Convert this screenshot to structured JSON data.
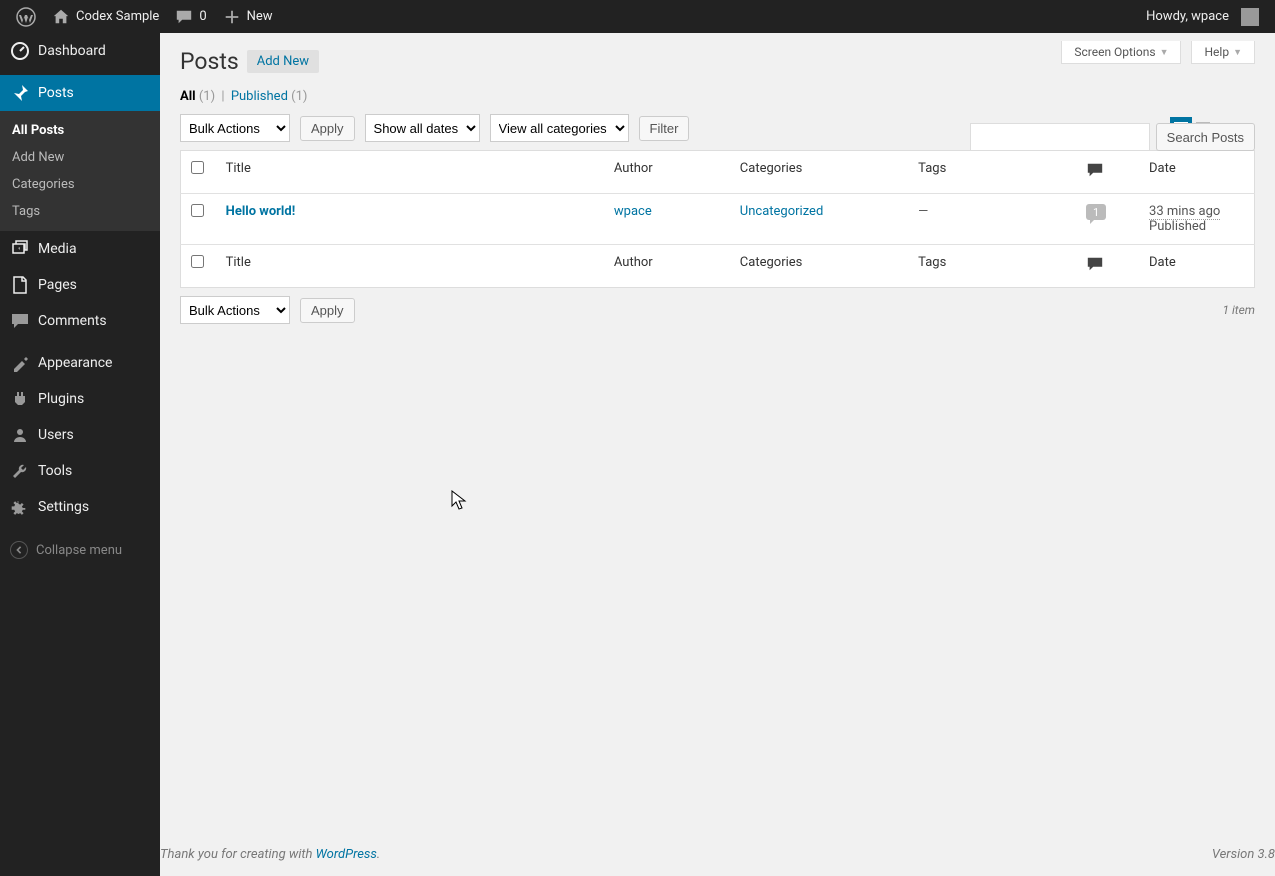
{
  "topbar": {
    "site_name": "Codex Sample",
    "comments_count": "0",
    "new_label": "New",
    "howdy": "Howdy, wpace"
  },
  "sidebar": {
    "items": [
      {
        "id": "dashboard",
        "label": "Dashboard"
      },
      {
        "id": "posts",
        "label": "Posts"
      },
      {
        "id": "media",
        "label": "Media"
      },
      {
        "id": "pages",
        "label": "Pages"
      },
      {
        "id": "comments",
        "label": "Comments"
      },
      {
        "id": "appearance",
        "label": "Appearance"
      },
      {
        "id": "plugins",
        "label": "Plugins"
      },
      {
        "id": "users",
        "label": "Users"
      },
      {
        "id": "tools",
        "label": "Tools"
      },
      {
        "id": "settings",
        "label": "Settings"
      }
    ],
    "submenu_posts": [
      {
        "label": "All Posts",
        "current": true
      },
      {
        "label": "Add New"
      },
      {
        "label": "Categories"
      },
      {
        "label": "Tags"
      }
    ],
    "collapse_label": "Collapse menu"
  },
  "screen": {
    "screen_options": "Screen Options",
    "help": "Help"
  },
  "page": {
    "title": "Posts",
    "add_new": "Add New"
  },
  "filters": {
    "all_label": "All",
    "all_count": "(1)",
    "published_label": "Published",
    "published_count": "(1)"
  },
  "search": {
    "button": "Search Posts"
  },
  "bulk_actions": {
    "label": "Bulk Actions",
    "apply": "Apply"
  },
  "date_filter": "Show all dates",
  "cat_filter": "View all categories",
  "filter_btn": "Filter",
  "item_count": "1 item",
  "columns": {
    "title": "Title",
    "author": "Author",
    "categories": "Categories",
    "tags": "Tags",
    "date": "Date"
  },
  "rows": [
    {
      "title": "Hello world!",
      "author": "wpace",
      "categories": "Uncategorized",
      "tags": "—",
      "comments": "1",
      "date_human": "33 mins ago",
      "status": "Published"
    }
  ],
  "footer": {
    "thank": "Thank you for creating with ",
    "wp": "WordPress",
    "version": "Version 3.8"
  }
}
